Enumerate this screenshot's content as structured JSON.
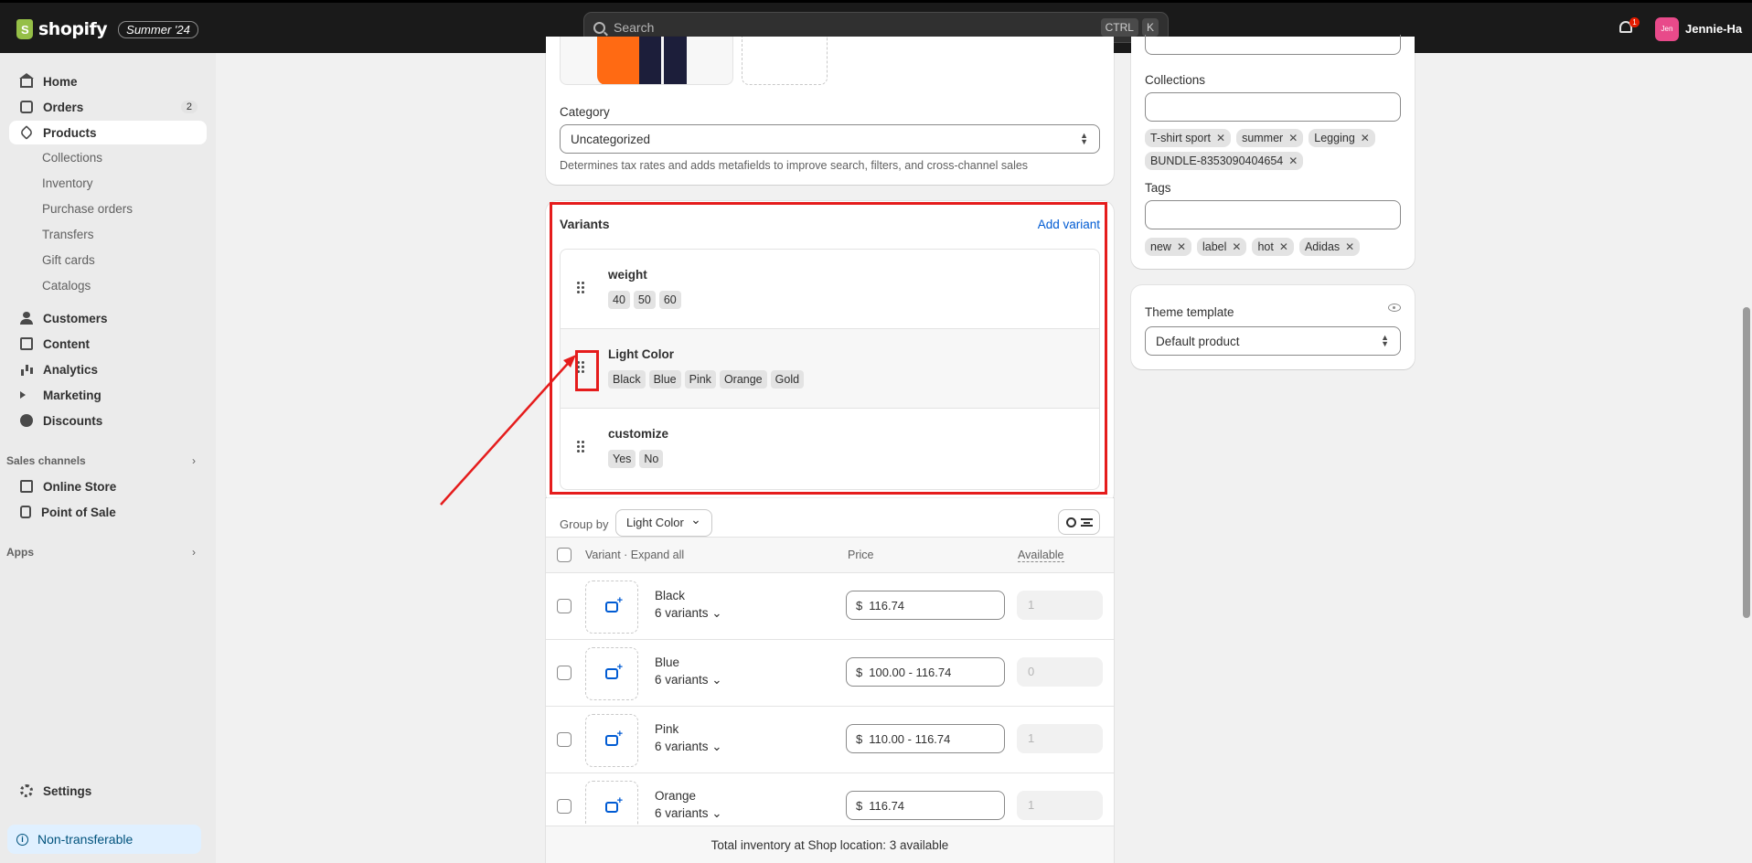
{
  "topbar": {
    "brand": "shopify",
    "edition_badge": "Summer '24",
    "search_placeholder": "Search",
    "shortcut_key1": "CTRL",
    "shortcut_key2": "K",
    "notification_count": "1",
    "avatar_initials": "Jen",
    "user_name": "Jennie-Ha"
  },
  "sidebar": {
    "home": "Home",
    "orders": "Orders",
    "orders_count": "2",
    "products": "Products",
    "sub_items": [
      "Collections",
      "Inventory",
      "Purchase orders",
      "Transfers",
      "Gift cards",
      "Catalogs"
    ],
    "customers": "Customers",
    "content": "Content",
    "analytics": "Analytics",
    "marketing": "Marketing",
    "discounts": "Discounts",
    "sales_channels": "Sales channels",
    "online_store": "Online Store",
    "point_of_sale": "Point of Sale",
    "apps": "Apps",
    "settings": "Settings",
    "notice": "Non-transferable"
  },
  "category": {
    "label": "Category",
    "value": "Uncategorized",
    "help": "Determines tax rates and adds metafields to improve search, filters, and cross-channel sales"
  },
  "variants": {
    "title": "Variants",
    "add_label": "Add variant",
    "options": [
      {
        "name": "weight",
        "values": [
          "40",
          "50",
          "60"
        ]
      },
      {
        "name": "Light Color",
        "values": [
          "Black",
          "Blue",
          "Pink",
          "Orange",
          "Gold"
        ]
      },
      {
        "name": "customize",
        "values": [
          "Yes",
          "No"
        ]
      }
    ]
  },
  "table": {
    "group_by_label": "Group by",
    "group_by_value": "Light Color",
    "col_variant": "Variant · Expand all",
    "col_price": "Price",
    "col_available": "Available",
    "currency": "$",
    "rows": [
      {
        "name": "Black",
        "count": "6 variants",
        "price": "116.74",
        "available": "1"
      },
      {
        "name": "Blue",
        "count": "6 variants",
        "price": "100.00 - 116.74",
        "available": "0"
      },
      {
        "name": "Pink",
        "count": "6 variants",
        "price": "110.00 - 116.74",
        "available": "1"
      },
      {
        "name": "Orange",
        "count": "6 variants",
        "price": "116.74",
        "available": "1"
      }
    ],
    "footer": "Total inventory at Shop location: 3 available"
  },
  "organization": {
    "collections_label": "Collections",
    "collections": [
      "T-shirt sport",
      "summer",
      "Legging",
      "BUNDLE-8353090404654"
    ],
    "tags_label": "Tags",
    "tags": [
      "new",
      "label",
      "hot",
      "Adidas"
    ]
  },
  "theme": {
    "label": "Theme template",
    "value": "Default product"
  },
  "colors": {
    "accent": "#005bd3",
    "annotation_red": "#e51c1c",
    "topbar": "#1a1a1a"
  }
}
